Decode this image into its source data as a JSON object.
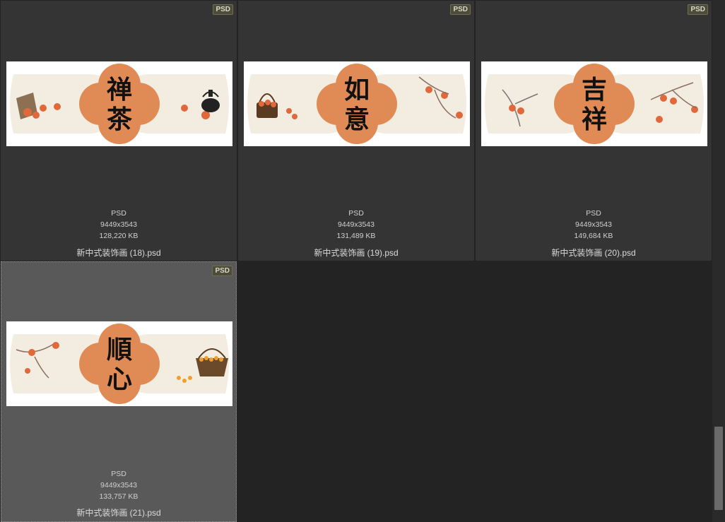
{
  "files": [
    {
      "badge": "PSD",
      "type": "PSD",
      "dimensions": "9449x3543",
      "size": "128,220 KB",
      "name": "新中式装饰画 (18).psd",
      "characters": [
        "禅",
        "茶"
      ],
      "selected": false
    },
    {
      "badge": "PSD",
      "type": "PSD",
      "dimensions": "9449x3543",
      "size": "131,489 KB",
      "name": "新中式装饰画 (19).psd",
      "characters": [
        "如",
        "意"
      ],
      "selected": false
    },
    {
      "badge": "PSD",
      "type": "PSD",
      "dimensions": "9449x3543",
      "size": "149,684 KB",
      "name": "新中式装饰画 (20).psd",
      "characters": [
        "吉",
        "祥"
      ],
      "selected": false
    },
    {
      "badge": "PSD",
      "type": "PSD",
      "dimensions": "9449x3543",
      "size": "133,757 KB",
      "name": "新中式装饰画 (21).psd",
      "characters": [
        "順",
        "心"
      ],
      "selected": true
    }
  ],
  "colors": {
    "background": "#232323",
    "tile": "#343434",
    "tile_selected": "#595959",
    "medallion": "#e08a55",
    "persimmon": "#e0683a",
    "paper": "#f3ece0"
  }
}
